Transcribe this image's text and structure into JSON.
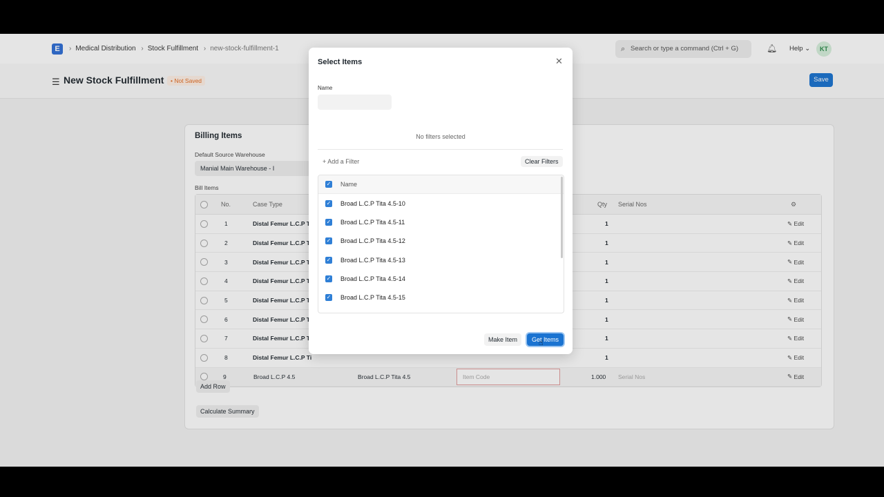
{
  "navbar": {
    "breadcrumbs": [
      "Medical Distribution",
      "Stock Fulfillment",
      "new-stock-fulfillment-1"
    ],
    "search_placeholder": "Search or type a command (Ctrl + G)",
    "help_label": "Help",
    "avatar_initials": "KT"
  },
  "page": {
    "title": "New Stock Fulfillment",
    "status": "Not Saved",
    "save_label": "Save"
  },
  "billing": {
    "section_title": "Billing Items",
    "warehouse_label": "Default Source Warehouse",
    "warehouse_value": "Manial Main Warehouse - I",
    "bill_items_label": "Bill Items",
    "columns": {
      "no": "No.",
      "case_type": "Case Type",
      "qty": "Qty",
      "serial": "Serial Nos"
    },
    "rows": [
      {
        "no": "1",
        "case_type": "Distal Femur L.C.P Ti",
        "qty": "1",
        "edit": "Edit"
      },
      {
        "no": "2",
        "case_type": "Distal Femur L.C.P Ti",
        "qty": "1",
        "edit": "Edit"
      },
      {
        "no": "3",
        "case_type": "Distal Femur L.C.P Ti",
        "qty": "1",
        "edit": "Edit"
      },
      {
        "no": "4",
        "case_type": "Distal Femur L.C.P Ti",
        "qty": "1",
        "edit": "Edit"
      },
      {
        "no": "5",
        "case_type": "Distal Femur L.C.P Ti",
        "qty": "1",
        "edit": "Edit"
      },
      {
        "no": "6",
        "case_type": "Distal Femur L.C.P Ti",
        "qty": "1",
        "edit": "Edit"
      },
      {
        "no": "7",
        "case_type": "Distal Femur L.C.P Ti",
        "qty": "1",
        "edit": "Edit"
      },
      {
        "no": "8",
        "case_type": "Distal Femur L.C.P Ti",
        "qty": "1",
        "edit": "Edit"
      }
    ],
    "row9": {
      "no": "9",
      "case_type": "Broad L.C.P 4.5",
      "item_name": "Broad L.C.P Tita 4.5",
      "item_code_placeholder": "Item Code",
      "qty": "1.000",
      "serial_placeholder": "Serial Nos",
      "edit": "Edit"
    },
    "add_row_label": "Add Row",
    "calc_label": "Calculate Summary"
  },
  "modal": {
    "title": "Select Items",
    "name_label": "Name",
    "no_filters": "No filters selected",
    "add_filter": "+ Add a Filter",
    "clear_filters": "Clear Filters",
    "list_header": "Name",
    "items": [
      "Broad L.C.P Tita 4.5-10",
      "Broad L.C.P Tita 4.5-11",
      "Broad L.C.P Tita 4.5-12",
      "Broad L.C.P Tita 4.5-13",
      "Broad L.C.P Tita 4.5-14",
      "Broad L.C.P Tita 4.5-15"
    ],
    "make_item": "Make Item",
    "get_items": "Get Items"
  }
}
